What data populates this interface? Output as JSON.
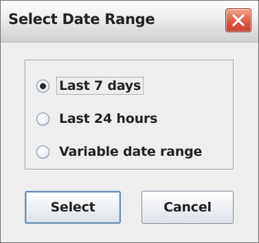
{
  "dialog": {
    "title": "Select Date Range",
    "close_icon": "close-icon",
    "colors": {
      "close_button": "#d8503a",
      "background": "#eeeeee"
    }
  },
  "options": {
    "selected": "Last 7 days",
    "items": [
      {
        "label": "Last 7 days",
        "checked": true
      },
      {
        "label": "Last 24 hours",
        "checked": false
      },
      {
        "label": "Variable date range",
        "checked": false
      }
    ]
  },
  "buttons": {
    "select_label": "Select",
    "cancel_label": "Cancel"
  }
}
